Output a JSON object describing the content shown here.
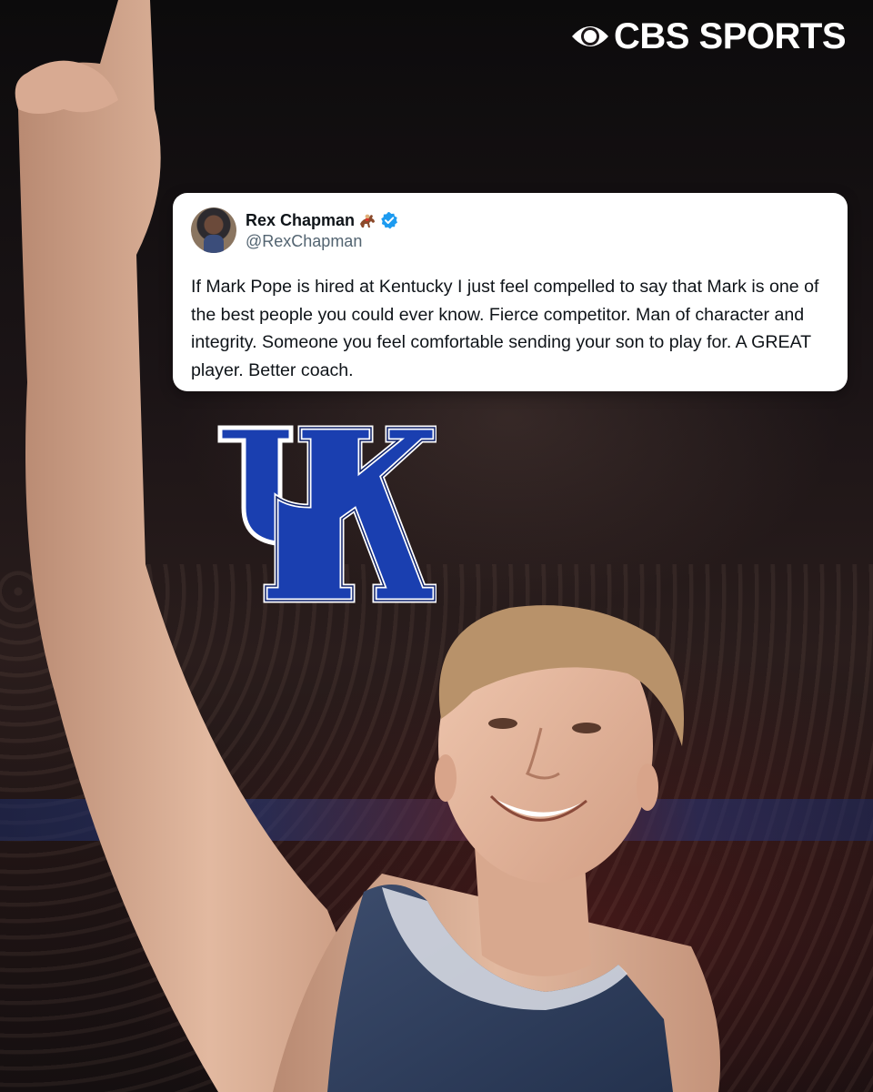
{
  "brand": {
    "logo_text": "CBS SPORTS"
  },
  "tweet": {
    "display_name": "Rex Chapman",
    "handle": "@RexChapman",
    "text": "If Mark Pope is hired at Kentucky I just feel compelled to say that Mark is one of the best people you could ever know. Fierce competitor. Man of character and integrity. Someone you feel comfortable sending your son to play for. A GREAT player. Better coach.",
    "icons": [
      "horse-racing-icon",
      "verified-badge-icon"
    ],
    "verified_color": "#1d9bf0"
  },
  "team_logo": {
    "text": "UK",
    "fill_color": "#1a3fb0",
    "outline_color": "#ffffff"
  },
  "colors": {
    "card_background": "#ffffff",
    "text_primary": "#0f1419",
    "text_secondary": "#536471",
    "logo_color": "#ffffff"
  }
}
